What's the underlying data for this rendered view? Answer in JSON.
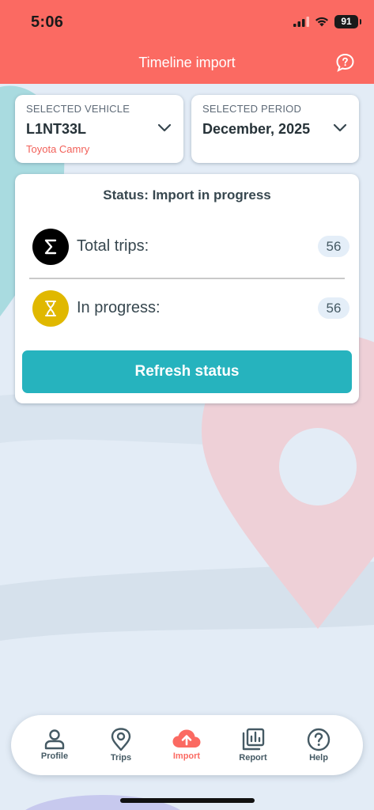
{
  "status_bar": {
    "time": "5:06",
    "battery": "91"
  },
  "header": {
    "title": "Timeline import",
    "help_icon": "chat-question-icon"
  },
  "vehicle": {
    "label": "SELECTED VEHICLE",
    "value": "L1NT33L",
    "sub": "Toyota Camry"
  },
  "period": {
    "label": "SELECTED PERIOD",
    "value": "December, 2025"
  },
  "status": {
    "title": "Status: Import in progress",
    "rows": [
      {
        "label": "Total trips:",
        "count": "56",
        "icon": "sigma-icon",
        "color": "#000000"
      },
      {
        "label": "In progress:",
        "count": "56",
        "icon": "hourglass-icon",
        "color": "#e0b800"
      }
    ],
    "refresh_label": "Refresh status"
  },
  "nav": {
    "items": [
      {
        "label": "Profile",
        "icon": "person-icon"
      },
      {
        "label": "Trips",
        "icon": "map-pin-icon"
      },
      {
        "label": "Import",
        "icon": "cloud-upload-icon",
        "active": true
      },
      {
        "label": "Report",
        "icon": "report-icon"
      },
      {
        "label": "Help",
        "icon": "help-circle-icon"
      }
    ]
  },
  "colors": {
    "header": "#fb6a62",
    "accent": "#26b3be",
    "active_nav": "#fb6a62",
    "background": "#e3ecf6"
  }
}
